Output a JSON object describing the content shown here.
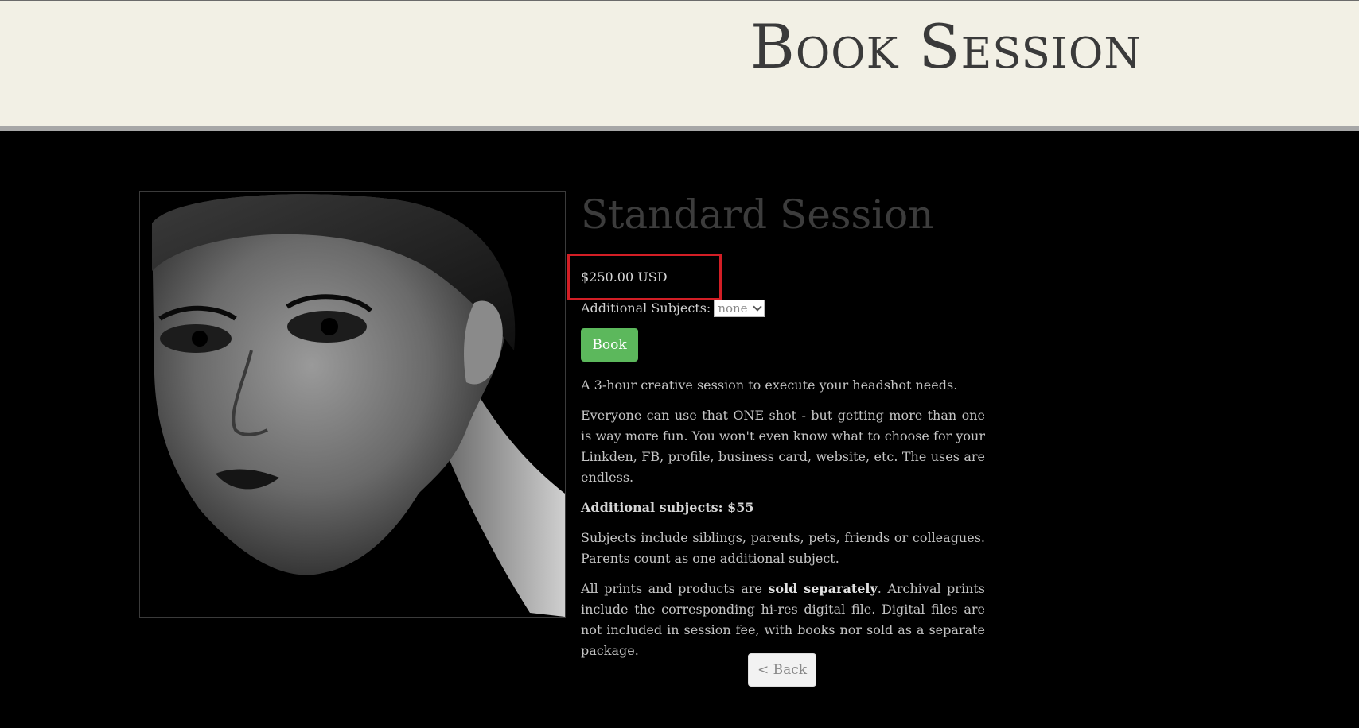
{
  "header": {
    "title": "Book Session"
  },
  "product": {
    "photo_alt": "Black and white headshot portrait",
    "title": "Standard Session",
    "price": "$250.00 USD",
    "subjects_label": "Additional Subjects:",
    "subjects_selected": "none",
    "book_label": "Book",
    "desc_1": "A 3-hour creative session to execute your headshot needs.",
    "desc_2": "Everyone can use that ONE shot - but getting more than one is way more fun. You won't even know what to choose for your Linkden, FB, profile, business card, website, etc. The uses are endless.",
    "desc_3": "Additional subjects: $55",
    "desc_4": "Subjects include siblings, parents, pets, friends or colleagues. Parents count as one additional subject.",
    "desc_5_pre": "All prints and products are ",
    "desc_5_bold": "sold separately",
    "desc_5_post": ". Archival prints include the corresponding hi-res digital file. Digital files are not included in session fee, with books nor sold as a separate package."
  },
  "nav": {
    "back_label": "< Back"
  },
  "colors": {
    "header_bg": "#f2f0e5",
    "page_bg": "#000000",
    "book_button": "#5cb85c",
    "highlight_border": "#d31e25"
  },
  "icons": {
    "select_arrow": "chevron-down-icon"
  }
}
